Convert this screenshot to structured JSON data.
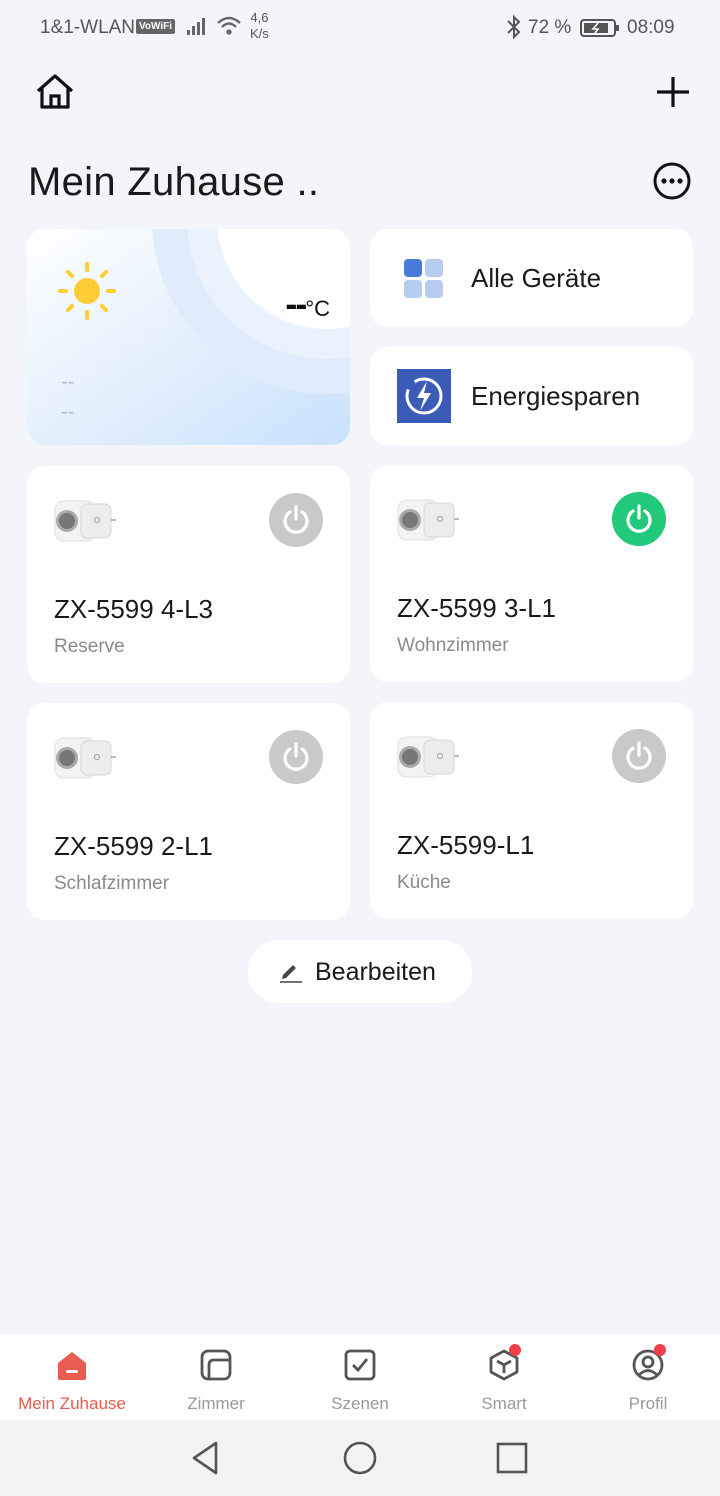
{
  "status_bar": {
    "carrier": "1&1-WLAN",
    "vowifi": "VoWiFi",
    "net_speed_value": "4,6",
    "net_speed_unit": "K/s",
    "battery": "72 %",
    "time": "08:09"
  },
  "header": {
    "title": "Mein Zuhause ..",
    "icons": {
      "home": "home-icon",
      "add": "plus-icon",
      "more": "more-icon"
    }
  },
  "weather": {
    "temperature": "--",
    "unit": "°C",
    "line1": "--",
    "line2": "--",
    "icon": "sun-icon"
  },
  "tiles": {
    "all_devices": "Alle Geräte",
    "energy": "Energiesparen"
  },
  "devices": [
    {
      "name": "ZX-5599 4-L3",
      "room": "Reserve",
      "on": false
    },
    {
      "name": "ZX-5599 3-L1",
      "room": "Wohnzimmer",
      "on": true
    },
    {
      "name": "ZX-5599 2-L1",
      "room": "Schlafzimmer",
      "on": false
    },
    {
      "name": "ZX-5599-L1",
      "room": "Küche",
      "on": false
    }
  ],
  "edit_button": "Bearbeiten",
  "tabs": [
    {
      "label": "Mein Zuhause",
      "active": true,
      "badge": false
    },
    {
      "label": "Zimmer",
      "active": false,
      "badge": false
    },
    {
      "label": "Szenen",
      "active": false,
      "badge": false
    },
    {
      "label": "Smart",
      "active": false,
      "badge": true
    },
    {
      "label": "Profil",
      "active": false,
      "badge": true
    }
  ],
  "colors": {
    "accent": "#e85b4f",
    "power_on": "#22c97a",
    "power_off": "#c9c9c9",
    "background": "#f3f5fa",
    "badge": "#f2404a"
  }
}
